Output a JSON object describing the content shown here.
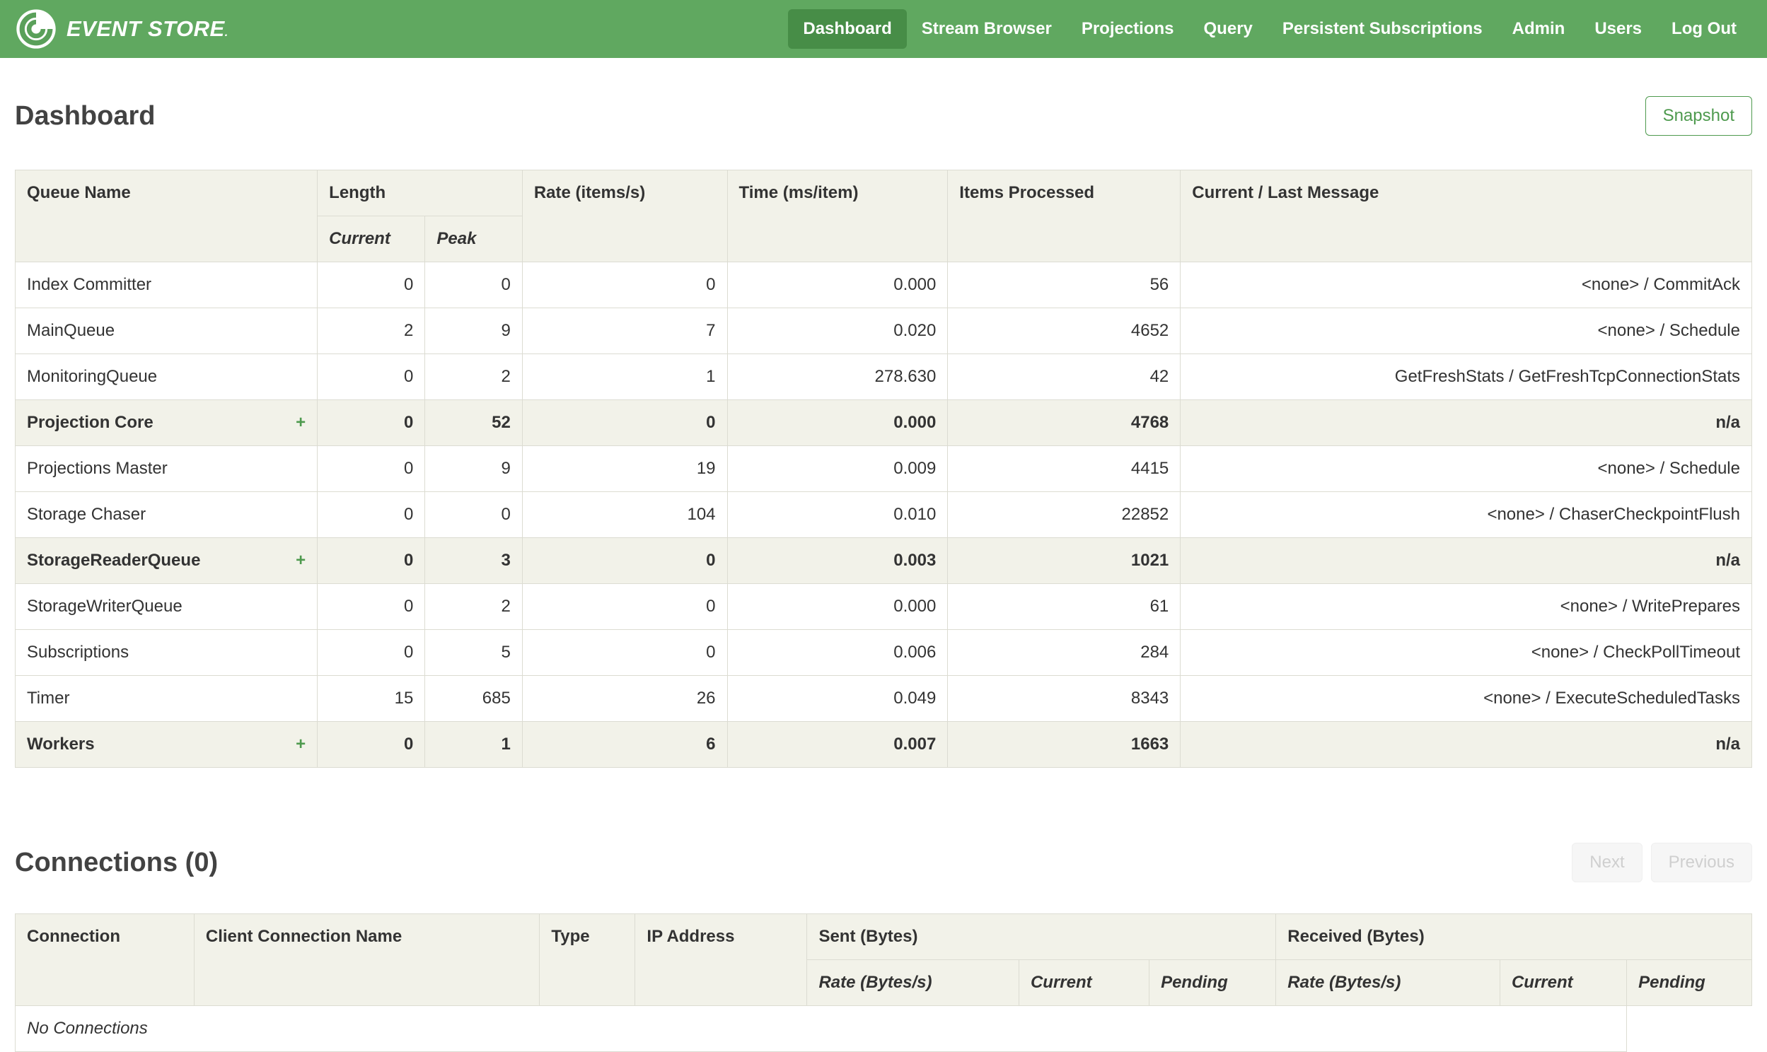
{
  "colors": {
    "navbar_green": "#60a860",
    "nav_active_green": "#478d47",
    "accent_green": "#4e9a4e",
    "header_bg": "#f2f2e9"
  },
  "brand": {
    "logo_text": "EVENT STORE",
    "tm": "."
  },
  "nav": {
    "items": [
      {
        "label": "Dashboard",
        "active": true
      },
      {
        "label": "Stream Browser",
        "active": false
      },
      {
        "label": "Projections",
        "active": false
      },
      {
        "label": "Query",
        "active": false
      },
      {
        "label": "Persistent Subscriptions",
        "active": false
      },
      {
        "label": "Admin",
        "active": false
      },
      {
        "label": "Users",
        "active": false
      },
      {
        "label": "Log Out",
        "active": false
      }
    ]
  },
  "page": {
    "title": "Dashboard",
    "snapshot_button": "Snapshot"
  },
  "queues": {
    "headers": {
      "queue_name": "Queue Name",
      "length": "Length",
      "current": "Current",
      "peak": "Peak",
      "rate": "Rate (items/s)",
      "time": "Time (ms/item)",
      "items_processed": "Items Processed",
      "message": "Current / Last Message"
    },
    "rows": [
      {
        "name": "Index Committer",
        "expander": "",
        "current": "0",
        "peak": "0",
        "rate": "0",
        "time": "0.000",
        "items": "56",
        "message": "<none> / CommitAck"
      },
      {
        "name": "MainQueue",
        "expander": "",
        "current": "2",
        "peak": "9",
        "rate": "7",
        "time": "0.020",
        "items": "4652",
        "message": "<none> / Schedule"
      },
      {
        "name": "MonitoringQueue",
        "expander": "",
        "current": "0",
        "peak": "2",
        "rate": "1",
        "time": "278.630",
        "items": "42",
        "message": "GetFreshStats / GetFreshTcpConnectionStats"
      },
      {
        "name": "Projection Core",
        "expander": "+",
        "current": "0",
        "peak": "52",
        "rate": "0",
        "time": "0.000",
        "items": "4768",
        "message": "n/a"
      },
      {
        "name": "Projections Master",
        "expander": "",
        "current": "0",
        "peak": "9",
        "rate": "19",
        "time": "0.009",
        "items": "4415",
        "message": "<none> / Schedule"
      },
      {
        "name": "Storage Chaser",
        "expander": "",
        "current": "0",
        "peak": "0",
        "rate": "104",
        "time": "0.010",
        "items": "22852",
        "message": "<none> / ChaserCheckpointFlush"
      },
      {
        "name": "StorageReaderQueue",
        "expander": "+",
        "current": "0",
        "peak": "3",
        "rate": "0",
        "time": "0.003",
        "items": "1021",
        "message": "n/a"
      },
      {
        "name": "StorageWriterQueue",
        "expander": "",
        "current": "0",
        "peak": "2",
        "rate": "0",
        "time": "0.000",
        "items": "61",
        "message": "<none> / WritePrepares"
      },
      {
        "name": "Subscriptions",
        "expander": "",
        "current": "0",
        "peak": "5",
        "rate": "0",
        "time": "0.006",
        "items": "284",
        "message": "<none> / CheckPollTimeout"
      },
      {
        "name": "Timer",
        "expander": "",
        "current": "15",
        "peak": "685",
        "rate": "26",
        "time": "0.049",
        "items": "8343",
        "message": "<none> / ExecuteScheduledTasks"
      },
      {
        "name": "Workers",
        "expander": "+",
        "current": "0",
        "peak": "1",
        "rate": "6",
        "time": "0.007",
        "items": "1663",
        "message": "n/a"
      }
    ]
  },
  "connections": {
    "title": "Connections (0)",
    "next_button": "Next",
    "previous_button": "Previous",
    "headers": {
      "connection": "Connection",
      "client_name": "Client Connection Name",
      "type": "Type",
      "ip": "IP Address",
      "sent": "Sent (Bytes)",
      "received": "Received (Bytes)",
      "rate": "Rate (Bytes/s)",
      "current": "Current",
      "pending": "Pending"
    },
    "empty": "No Connections"
  }
}
